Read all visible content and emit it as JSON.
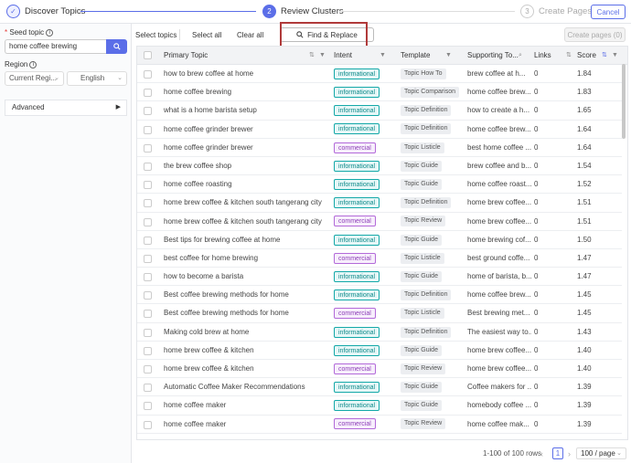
{
  "steps": [
    {
      "num": "✓",
      "label": "Discover Topics"
    },
    {
      "num": "2",
      "label": "Review Clusters"
    },
    {
      "num": "3",
      "label": "Create Pages"
    }
  ],
  "header": {
    "cancel_label": "Cancel"
  },
  "sidebar": {
    "seed_label": "Seed topic",
    "seed_value": "home coffee brewing",
    "region_label": "Region",
    "region_value": "Current Regi...",
    "language_value": "English",
    "advanced_label": "Advanced"
  },
  "toolbar": {
    "select_topics": "Select topics",
    "select_all": "Select all",
    "clear_all": "Clear all",
    "find_replace": "Find & Replace",
    "create_pages": "Create pages (0)"
  },
  "table": {
    "columns": [
      "Primary Topic",
      "Intent",
      "Template",
      "Supporting To...",
      "Links",
      "Score"
    ],
    "rows": [
      {
        "topic": "how to brew coffee at home",
        "intent": "informational",
        "template": "Topic How To",
        "supporting": "brew coffee at h...",
        "links": "0",
        "score": "1.84"
      },
      {
        "topic": "home coffee brewing",
        "intent": "informational",
        "template": "Topic Comparison",
        "supporting": "home coffee brew...",
        "links": "0",
        "score": "1.83"
      },
      {
        "topic": "what is a home barista setup",
        "intent": "informational",
        "template": "Topic Definition",
        "supporting": "how to create a h...",
        "links": "0",
        "score": "1.65"
      },
      {
        "topic": "home coffee grinder brewer",
        "intent": "informational",
        "template": "Topic Definition",
        "supporting": "home coffee brew...",
        "links": "0",
        "score": "1.64"
      },
      {
        "topic": "home coffee grinder brewer",
        "intent": "commercial",
        "template": "Topic Listicle",
        "supporting": "best home coffee ...",
        "links": "0",
        "score": "1.64"
      },
      {
        "topic": "the brew coffee shop",
        "intent": "informational",
        "template": "Topic Guide",
        "supporting": "brew coffee and b...",
        "links": "0",
        "score": "1.54"
      },
      {
        "topic": "home coffee roasting",
        "intent": "informational",
        "template": "Topic Guide",
        "supporting": "home coffee roast...",
        "links": "0",
        "score": "1.52"
      },
      {
        "topic": "home brew coffee & kitchen south tangerang city",
        "intent": "informational",
        "template": "Topic Definition",
        "supporting": "home brew coffee...",
        "links": "0",
        "score": "1.51"
      },
      {
        "topic": "home brew coffee & kitchen south tangerang city",
        "intent": "commercial",
        "template": "Topic Review",
        "supporting": "home brew coffee...",
        "links": "0",
        "score": "1.51"
      },
      {
        "topic": "Best tips for brewing coffee at home",
        "intent": "informational",
        "template": "Topic Guide",
        "supporting": "home brewing cof...",
        "links": "0",
        "score": "1.50"
      },
      {
        "topic": "best coffee for home brewing",
        "intent": "commercial",
        "template": "Topic Listicle",
        "supporting": "best ground coffe...",
        "links": "0",
        "score": "1.47"
      },
      {
        "topic": "how to become a barista",
        "intent": "informational",
        "template": "Topic Guide",
        "supporting": "home of barista, b...",
        "links": "0",
        "score": "1.47"
      },
      {
        "topic": "Best coffee brewing methods for home",
        "intent": "informational",
        "template": "Topic Definition",
        "supporting": "home coffee brew...",
        "links": "0",
        "score": "1.45"
      },
      {
        "topic": "Best coffee brewing methods for home",
        "intent": "commercial",
        "template": "Topic Listicle",
        "supporting": "Best brewing met...",
        "links": "0",
        "score": "1.45"
      },
      {
        "topic": "Making cold brew at home",
        "intent": "informational",
        "template": "Topic Definition",
        "supporting": "The easiest way to...",
        "links": "0",
        "score": "1.43"
      },
      {
        "topic": "home brew coffee & kitchen",
        "intent": "informational",
        "template": "Topic Guide",
        "supporting": "home brew coffee...",
        "links": "0",
        "score": "1.40"
      },
      {
        "topic": "home brew coffee & kitchen",
        "intent": "commercial",
        "template": "Topic Review",
        "supporting": "home brew coffee...",
        "links": "0",
        "score": "1.40"
      },
      {
        "topic": "Automatic Coffee Maker Recommendations",
        "intent": "informational",
        "template": "Topic Guide",
        "supporting": "Coffee makers for ...",
        "links": "0",
        "score": "1.39"
      },
      {
        "topic": "home coffee maker",
        "intent": "informational",
        "template": "Topic Guide",
        "supporting": "homebody coffee ...",
        "links": "0",
        "score": "1.39"
      },
      {
        "topic": "home coffee maker",
        "intent": "commercial",
        "template": "Topic Review",
        "supporting": "home coffee mak...",
        "links": "0",
        "score": "1.39"
      }
    ]
  },
  "footer": {
    "range": "1-100 of 100 rows",
    "page": "1",
    "per_page": "100 / page"
  }
}
